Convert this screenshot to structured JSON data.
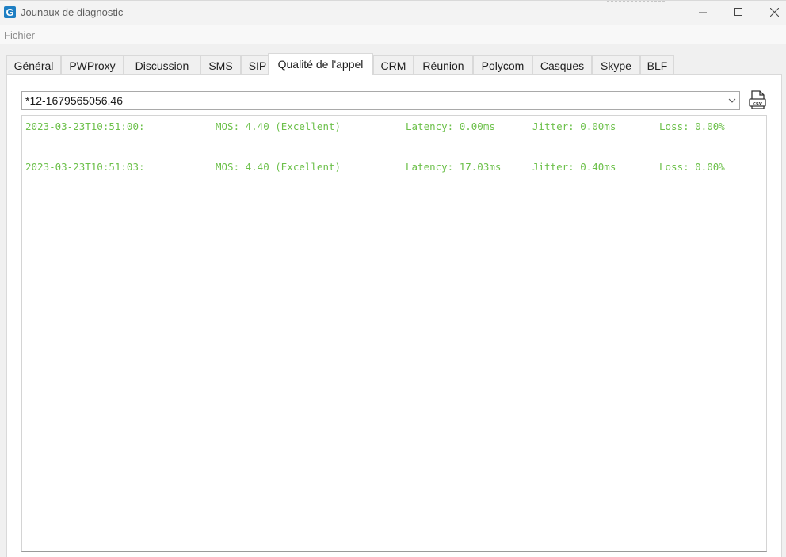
{
  "window": {
    "title": "Jounaux de diagnostic",
    "app_icon_letter": "G"
  },
  "menu": {
    "file_label": "Fichier"
  },
  "tabs": [
    {
      "label": "Général",
      "active": false
    },
    {
      "label": "PWProxy",
      "active": false
    },
    {
      "label": "Discussion",
      "active": false
    },
    {
      "label": "SMS",
      "active": false
    },
    {
      "label": "SIP",
      "active": false
    },
    {
      "label": "Qualité de l'appel",
      "active": true
    },
    {
      "label": "CRM",
      "active": false
    },
    {
      "label": "Réunion",
      "active": false
    },
    {
      "label": "Polycom",
      "active": false
    },
    {
      "label": "Casques",
      "active": false
    },
    {
      "label": "Skype",
      "active": false
    },
    {
      "label": "BLF",
      "active": false
    }
  ],
  "call_selector": {
    "value": "*12-1679565056.46"
  },
  "export": {
    "icon": "csv-file-icon",
    "icon_text": "csv"
  },
  "log": {
    "entries": [
      {
        "timestamp": "2023-03-23T10:51:00:",
        "mos": "MOS: 4.40 (Excellent)",
        "latency": "Latency: 0.00ms",
        "jitter": "Jitter: 0.00ms",
        "loss": "Loss: 0.00%"
      },
      {
        "timestamp": "2023-03-23T10:51:03:",
        "mos": "MOS: 4.40 (Excellent)",
        "latency": "Latency: 17.03ms",
        "jitter": "Jitter: 0.40ms",
        "loss": "Loss: 0.00%"
      }
    ]
  },
  "colors": {
    "log_text": "#6cc04a",
    "app_icon": "#1e7fc3"
  }
}
